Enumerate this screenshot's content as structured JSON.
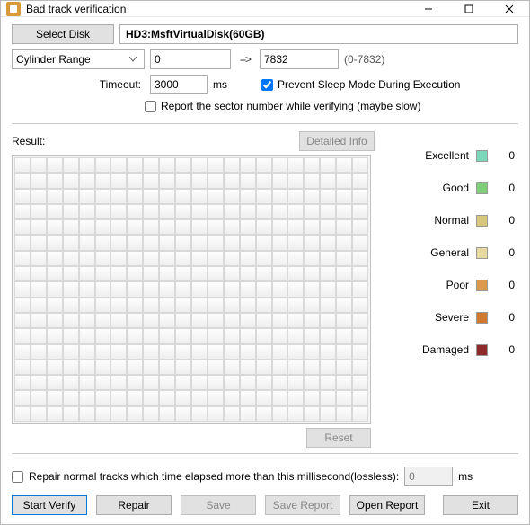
{
  "titlebar": {
    "title": "Bad track verification"
  },
  "controls": {
    "select_disk": "Select Disk",
    "disk_name": "HD3:MsftVirtualDisk(60GB)",
    "range_mode": "Cylinder Range",
    "range_start": "0",
    "range_end": "7832",
    "range_hint": "(0-7832)",
    "timeout_label": "Timeout:",
    "timeout_value": "3000",
    "timeout_unit": "ms",
    "prevent_sleep": "Prevent Sleep Mode During Execution",
    "report_sector": "Report the sector number while verifying (maybe slow)"
  },
  "result": {
    "label": "Result:",
    "detailed_info": "Detailed Info",
    "reset": "Reset",
    "grid_cols": 22,
    "grid_rows": 17
  },
  "legend": [
    {
      "label": "Excellent",
      "color": "#7ad7b9",
      "count": 0
    },
    {
      "label": "Good",
      "color": "#7fcf7a",
      "count": 0
    },
    {
      "label": "Normal",
      "color": "#d6c77a",
      "count": 0
    },
    {
      "label": "General",
      "color": "#e8dba0",
      "count": 0
    },
    {
      "label": "Poor",
      "color": "#dc9a4a",
      "count": 0
    },
    {
      "label": "Severe",
      "color": "#cf7a2e",
      "count": 0
    },
    {
      "label": "Damaged",
      "color": "#8e2a2a",
      "count": 0
    }
  ],
  "bottom": {
    "repair_label": "Repair normal tracks which time elapsed more than this millisecond(lossless):",
    "repair_ms": "0",
    "repair_unit": "ms"
  },
  "buttons": {
    "start": "Start Verify",
    "repair": "Repair",
    "save": "Save",
    "save_report": "Save Report",
    "open_report": "Open Report",
    "exit": "Exit"
  }
}
